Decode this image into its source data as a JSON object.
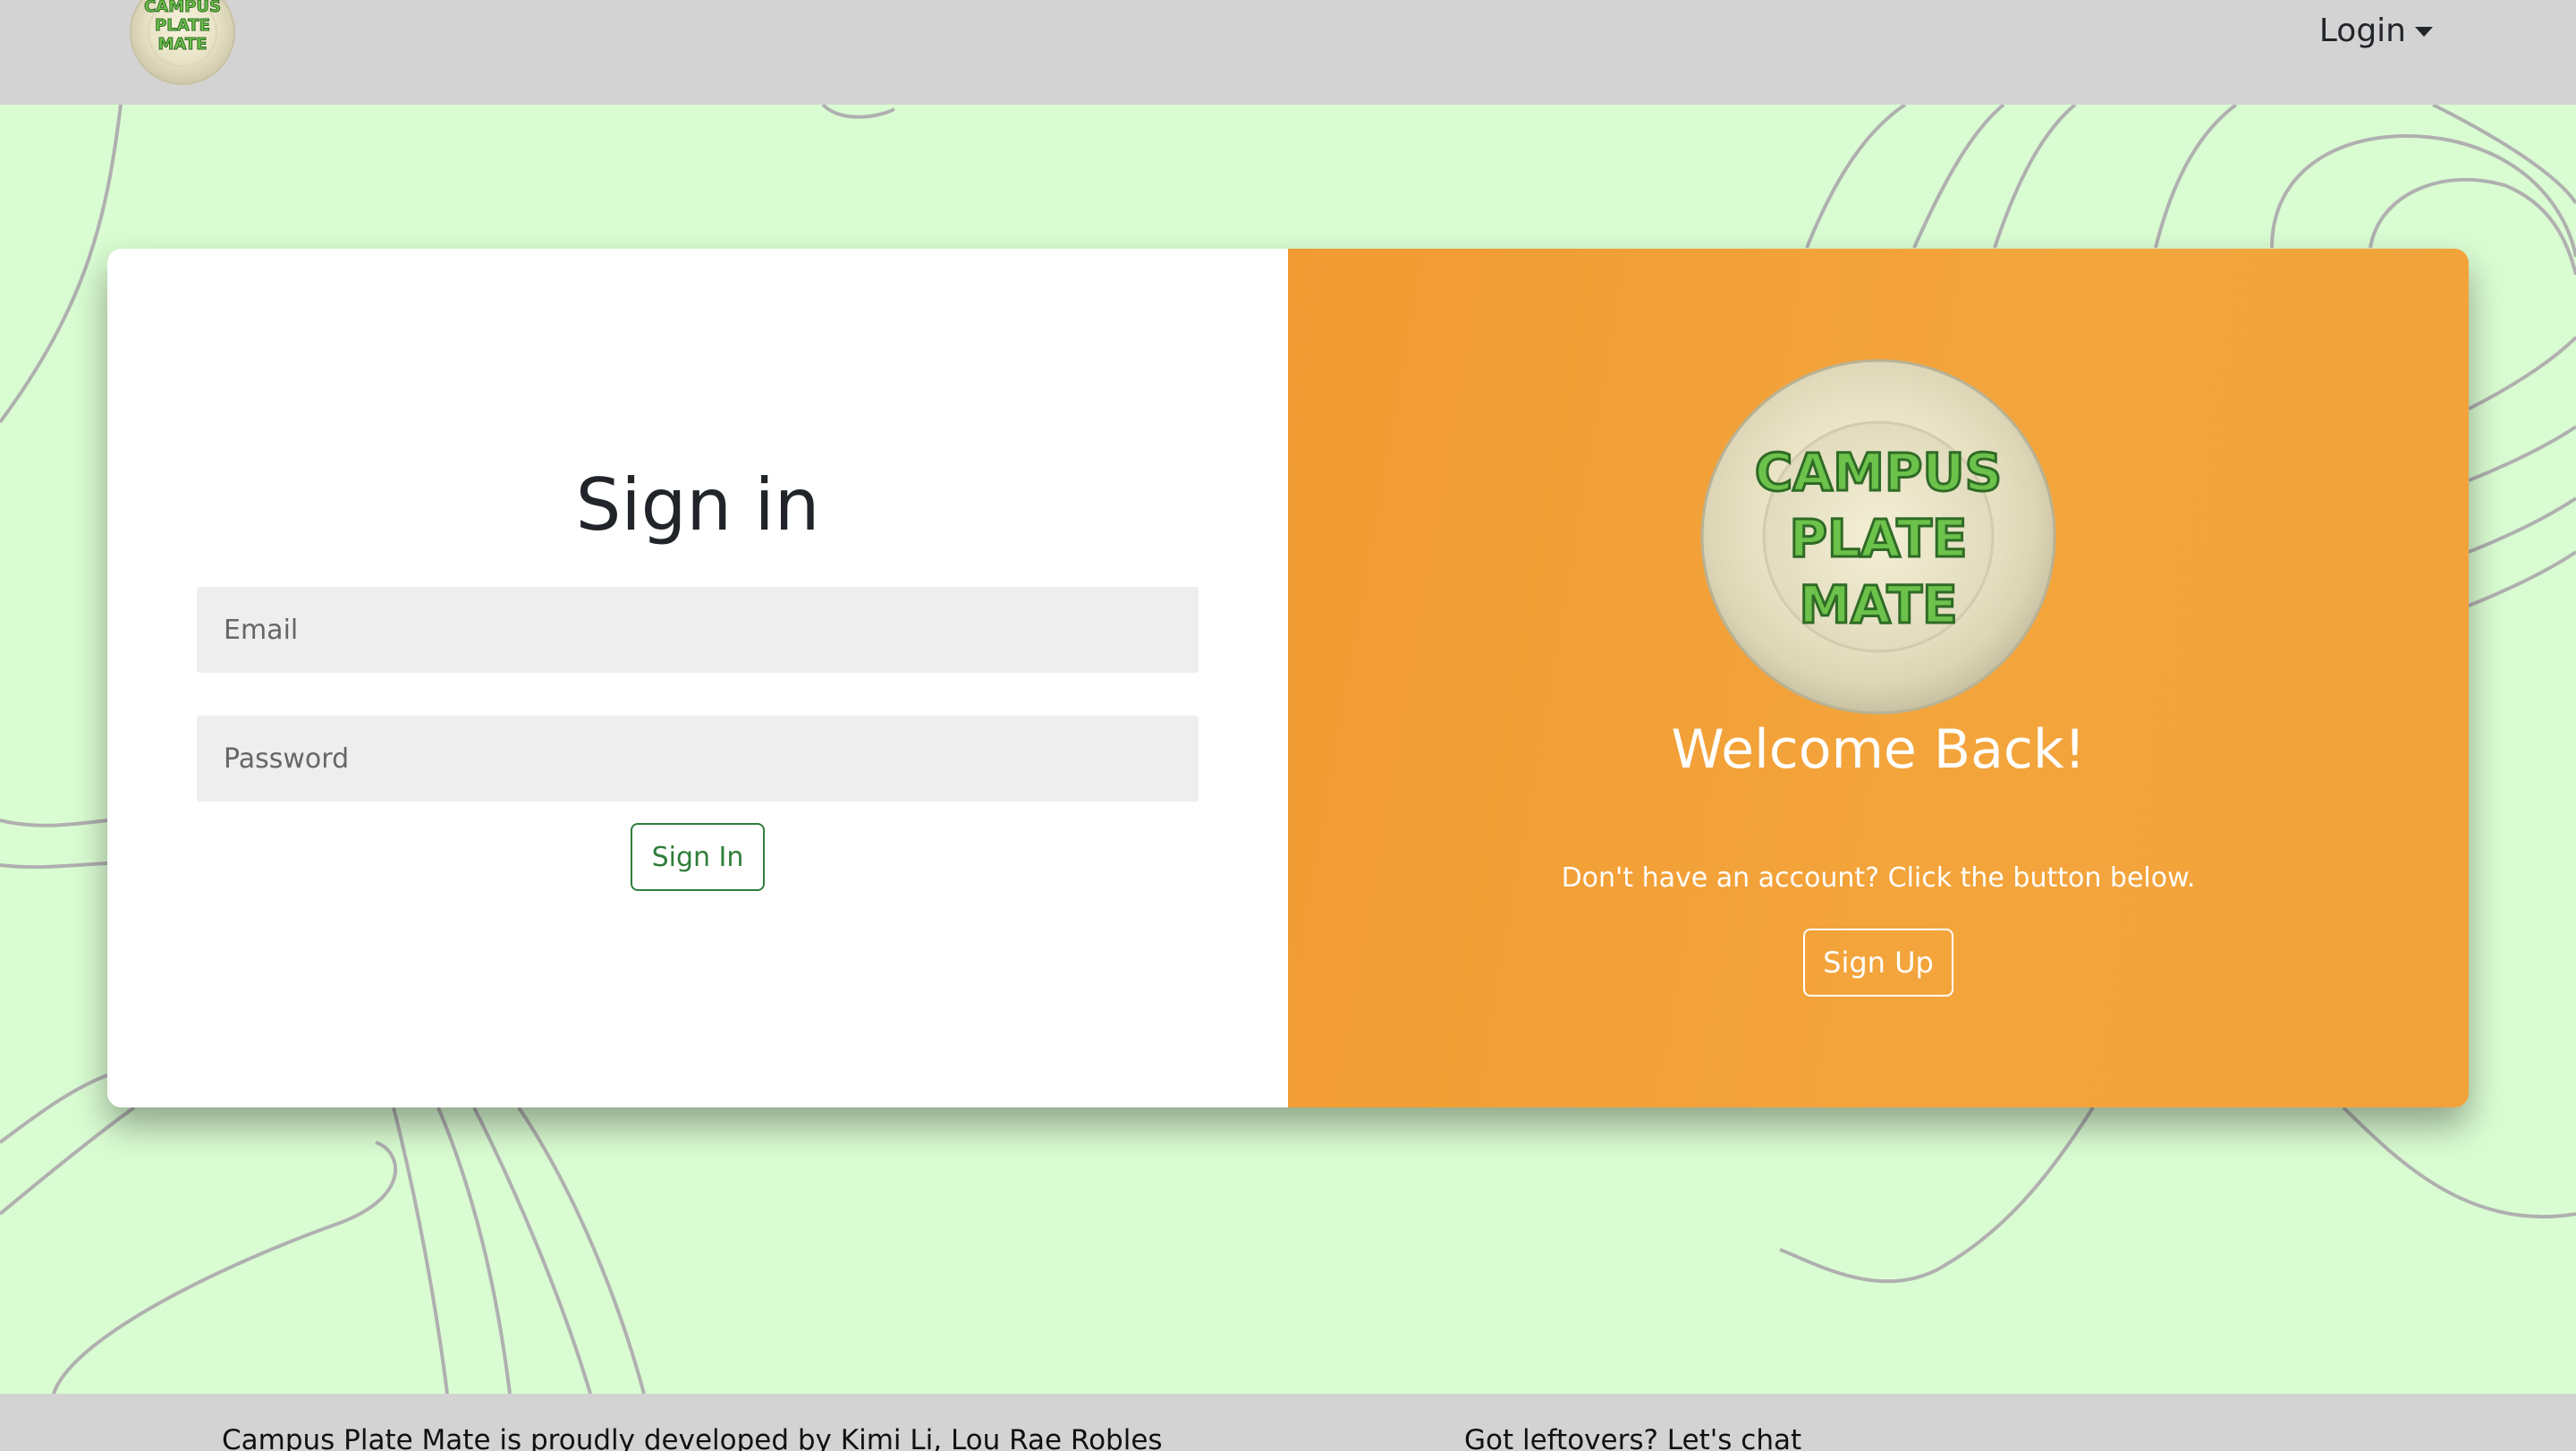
{
  "navbar": {
    "logo_text": [
      "CAMPUS",
      "PLATE",
      "MATE"
    ],
    "login_label": "Login"
  },
  "signin": {
    "title": "Sign in",
    "email_placeholder": "Email",
    "password_placeholder": "Password",
    "button_label": "Sign In"
  },
  "welcome_panel": {
    "logo_text": [
      "CAMPUS",
      "PLATE",
      "MATE"
    ],
    "heading": "Welcome Back!",
    "message": "Don't have an account? Click the button below.",
    "button_label": "Sign Up"
  },
  "footer": {
    "credit": "Campus Plate Mate is proudly developed by Kimi Li, Lou Rae Robles",
    "chat": "Got leftovers? Let's chat"
  },
  "colors": {
    "background": "#dafcd2",
    "navbar": "#d3d3d3",
    "panel_orange": "#f3a53c",
    "signin_green": "#2f7d3a",
    "logo_green": "#6cc24a"
  },
  "icons": {
    "login_dropdown": "caret-down-icon",
    "logo": "plate-logo"
  }
}
